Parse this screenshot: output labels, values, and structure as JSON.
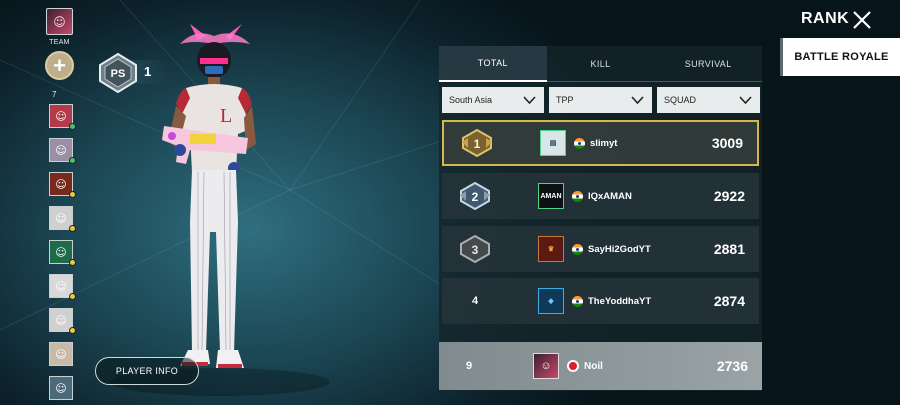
{
  "sidebar": {
    "team_label": "TEAM",
    "friend_count": "7",
    "add_symbol": "+",
    "friends": [
      {
        "icon": "friend-avatar-icon",
        "bg": "#b23a4a",
        "status": "#4cc36b"
      },
      {
        "icon": "friend-avatar-icon",
        "bg": "#9b8fa8",
        "status": "#4cc36b"
      },
      {
        "icon": "friend-avatar-icon",
        "bg": "#7a2a1a",
        "status": "#f0c63a"
      },
      {
        "icon": "friend-avatar-icon",
        "bg": "#cfcfcf",
        "status": "#f0c63a"
      },
      {
        "icon": "friend-avatar-icon",
        "bg": "#1e6b4a",
        "status": "#f0c63a"
      },
      {
        "icon": "friend-avatar-icon",
        "bg": "#d8d8d8",
        "status": "#f0c63a"
      },
      {
        "icon": "friend-avatar-icon",
        "bg": "#d0d0d0",
        "status": "#f0c63a"
      },
      {
        "icon": "friend-avatar-icon",
        "bg": "#c9b9a9",
        "status": ""
      },
      {
        "icon": "friend-avatar-icon",
        "bg": "#4b6a7a",
        "status": ""
      }
    ]
  },
  "rank_badge": {
    "text": "PS",
    "level": "1"
  },
  "player_info_label": "PLAYER INFO",
  "header": {
    "title": "RANK",
    "close_icon": "close-icon",
    "mode_tab": "BATTLE ROYALE"
  },
  "tabs": [
    {
      "label": "TOTAL",
      "active": true
    },
    {
      "label": "KILL",
      "active": false
    },
    {
      "label": "SURVIVAL",
      "active": false
    }
  ],
  "filters": [
    {
      "value": "South Asia"
    },
    {
      "value": "TPP"
    },
    {
      "value": "SQUAD"
    }
  ],
  "leaderboard": [
    {
      "rank": "1",
      "name": "slimyt",
      "score": "3009",
      "avatar_text": "",
      "avatar_bg": "#d9e6e8",
      "medal": "gold"
    },
    {
      "rank": "2",
      "name": "IQxAMAN",
      "score": "2922",
      "avatar_text": "AMAN",
      "avatar_bg": "#0e1114",
      "medal": "silver"
    },
    {
      "rank": "3",
      "name": "SayHi2GodYT",
      "score": "2881",
      "avatar_text": "",
      "avatar_bg": "#5a1a12",
      "medal": "bronze"
    },
    {
      "rank": "4",
      "name": "TheYoddhaYT",
      "score": "2874",
      "avatar_text": "",
      "avatar_bg": "#0f3a57",
      "medal": ""
    }
  ],
  "my_rank": {
    "rank": "9",
    "name": "Noil",
    "score": "2736"
  },
  "colors": {
    "highlight_border": "#d6b84a",
    "gold": "#c9a34a",
    "silver": "#8e9ca6",
    "bronze": "#7b7f82"
  }
}
